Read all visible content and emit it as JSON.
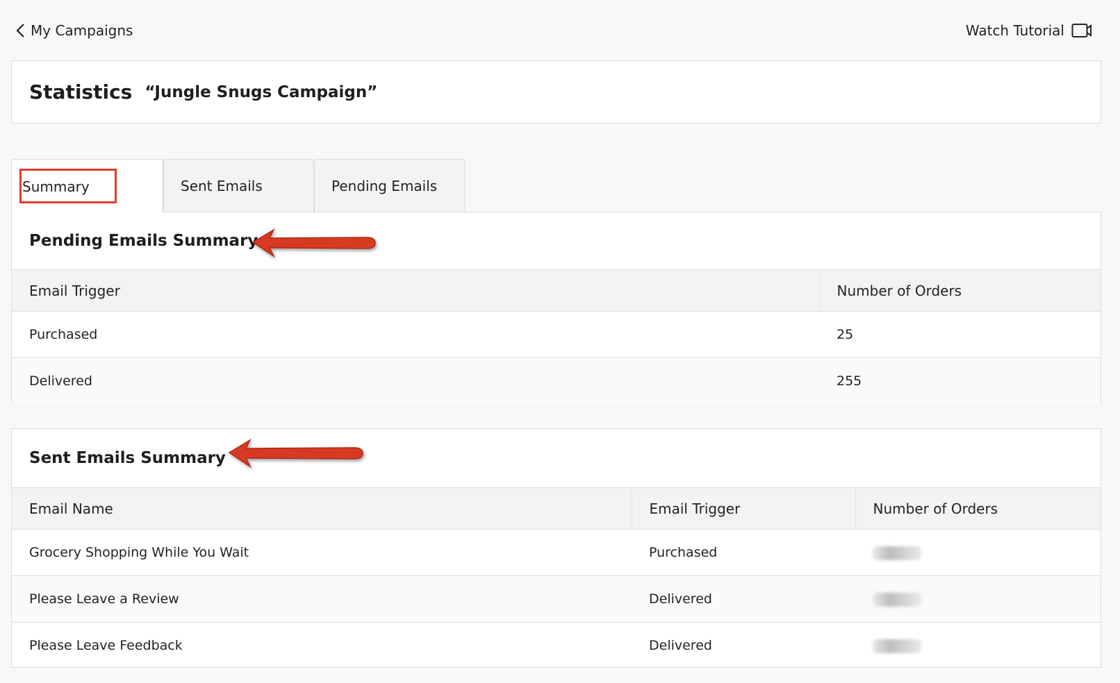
{
  "nav": {
    "back_label": "My Campaigns",
    "tutorial_label": "Watch Tutorial"
  },
  "header": {
    "title": "Statistics",
    "campaign_name": "“Jungle Snugs Campaign”"
  },
  "tabs": [
    {
      "label": "Summary",
      "active": true
    },
    {
      "label": "Sent Emails",
      "active": false
    },
    {
      "label": "Pending Emails",
      "active": false
    }
  ],
  "pending_summary": {
    "title": "Pending Emails Summary",
    "columns": [
      "Email Trigger",
      "Number of Orders"
    ],
    "rows": [
      {
        "trigger": "Purchased",
        "orders": "25"
      },
      {
        "trigger": "Delivered",
        "orders": "255"
      }
    ]
  },
  "sent_summary": {
    "title": "Sent Emails Summary",
    "columns": [
      "Email Name",
      "Email Trigger",
      "Number of Orders"
    ],
    "rows": [
      {
        "name": "Grocery Shopping While You Wait",
        "trigger": "Purchased",
        "orders": "blurred"
      },
      {
        "name": "Please Leave a Review",
        "trigger": "Delivered",
        "orders": "blurred"
      },
      {
        "name": "Please Leave Feedback",
        "trigger": "Delivered",
        "orders": "blurred"
      }
    ]
  },
  "colors": {
    "annotation_red": "#e23b2a",
    "border": "#dcdcdc",
    "header_bg": "#f3f3f3"
  }
}
